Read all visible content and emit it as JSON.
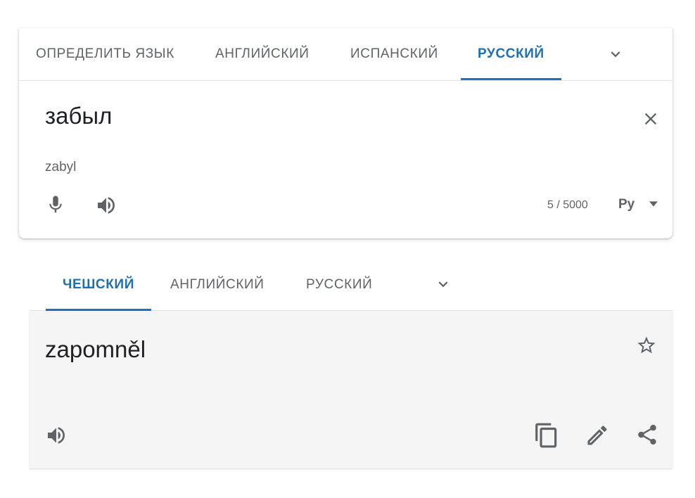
{
  "source": {
    "tabs": [
      {
        "label": "ОПРЕДЕЛИТЬ ЯЗЫК",
        "active": false
      },
      {
        "label": "АНГЛИЙСКИЙ",
        "active": false
      },
      {
        "label": "ИСПАНСКИЙ",
        "active": false
      },
      {
        "label": "РУССКИЙ",
        "active": true
      }
    ],
    "more_languages_icon": "chevron-down-icon",
    "text": "забыл",
    "transliteration": "zabyl",
    "clear_icon": "close-icon",
    "mic_icon": "microphone-icon",
    "listen_icon": "speaker-icon",
    "char_count": "5 / 5000",
    "input_tool": "Pу",
    "input_tool_caret": "caret-down-icon"
  },
  "target": {
    "tabs": [
      {
        "label": "ЧЕШСКИЙ",
        "active": true
      },
      {
        "label": "АНГЛИЙСКИЙ",
        "active": false
      },
      {
        "label": "РУССКИЙ",
        "active": false
      }
    ],
    "more_languages_icon": "chevron-down-icon",
    "text": "zapomněl",
    "star_icon": "star-outline-icon",
    "listen_icon": "speaker-icon",
    "copy_icon": "copy-icon",
    "edit_icon": "pencil-icon",
    "share_icon": "share-icon"
  },
  "colors": {
    "accent": "#1a73e8",
    "icon": "#5f6368",
    "text": "#202124",
    "target_bg": "#f5f5f5"
  }
}
